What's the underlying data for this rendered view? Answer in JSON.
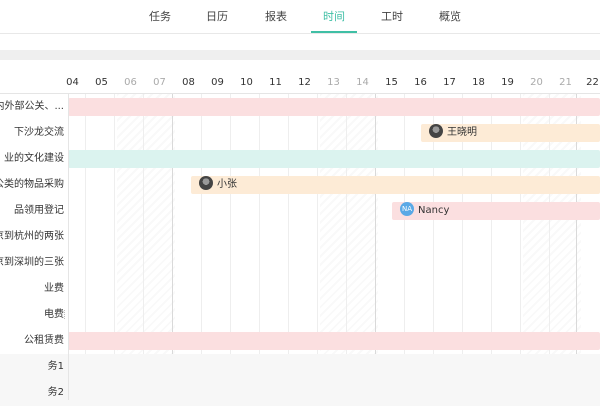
{
  "tabs": [
    {
      "label": "任务",
      "active": false
    },
    {
      "label": "日历",
      "active": false
    },
    {
      "label": "报表",
      "active": false
    },
    {
      "label": "时间",
      "active": true
    },
    {
      "label": "工时",
      "active": false
    },
    {
      "label": "概览",
      "active": false
    }
  ],
  "timeline": {
    "days": [
      "04",
      "05",
      "06",
      "07",
      "08",
      "09",
      "10",
      "11",
      "12",
      "13",
      "14",
      "15",
      "16",
      "17",
      "18",
      "19",
      "20",
      "21",
      "22"
    ],
    "weekend_days": [
      "06",
      "07",
      "13",
      "14",
      "20",
      "21"
    ]
  },
  "tasks": [
    {
      "label": "司内外部公关、..."
    },
    {
      "label": "下沙龙交流",
      "assignee": "王晓明"
    },
    {
      "label": "业的文化建设"
    },
    {
      "label": "公类的物品采购",
      "assignee": "小张"
    },
    {
      "label": "品领用登记",
      "assignee": "Nancy",
      "avatar_text": "NA"
    },
    {
      "label": "京到杭州的两张"
    },
    {
      "label": "京到深圳的三张"
    },
    {
      "label": "业费"
    },
    {
      "label": "电费"
    },
    {
      "label": "公租赁费"
    },
    {
      "label": "务1"
    },
    {
      "label": "务2"
    }
  ],
  "colors": {
    "accent": "#3fbfa5",
    "pink": "#fbdfe0",
    "peach": "#fdebd6",
    "mint": "#dbf3ef"
  }
}
